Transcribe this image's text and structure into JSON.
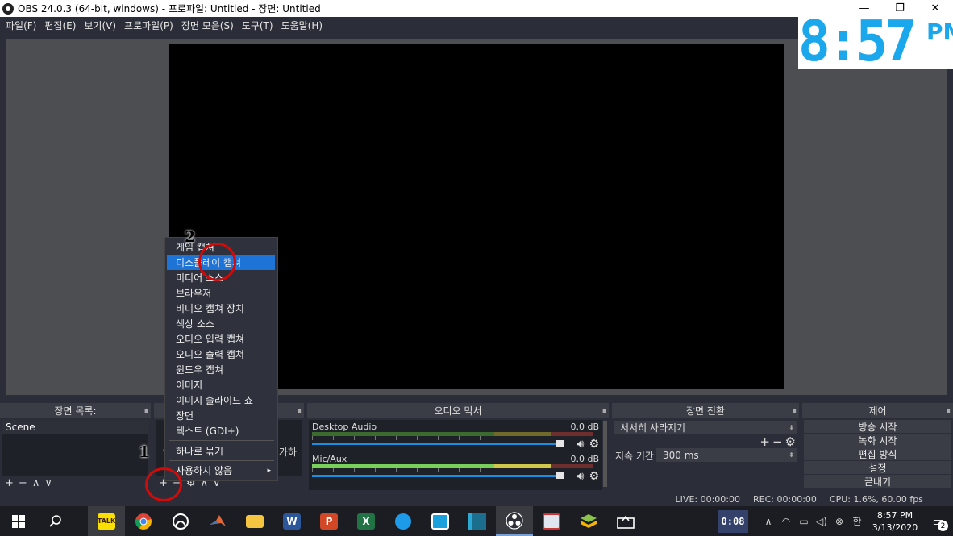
{
  "window": {
    "title": "OBS 24.0.3 (64-bit, windows) - 프로파일: Untitled - 장면: Untitled"
  },
  "menu": [
    "파일(F)",
    "편집(E)",
    "보기(V)",
    "프로파일(P)",
    "장면 모음(S)",
    "도구(T)",
    "도움말(H)"
  ],
  "clock_overlay": {
    "time": "8:57",
    "ampm": "PM"
  },
  "docks": {
    "scenes": {
      "title": "장면 목록:",
      "items": [
        "Scene"
      ],
      "footer": [
        "+",
        "−",
        "∧",
        "∨"
      ]
    },
    "sources": {
      "partial_text_left": "C",
      "partial_text_right": "가하",
      "footer": [
        "+",
        "−",
        "⚙",
        "∧",
        "∨"
      ]
    },
    "mixer": {
      "title": "오디오 믹서",
      "channels": [
        {
          "name": "Desktop Audio",
          "level": "0.0 dB",
          "active": false
        },
        {
          "name": "Mic/Aux",
          "level": "0.0 dB",
          "active": true
        }
      ]
    },
    "transitions": {
      "title": "장면 전환",
      "selected": "서서히 사라지기",
      "duration_label": "지속 기간",
      "duration_value": "300 ms"
    },
    "controls": {
      "title": "제어",
      "buttons": [
        "방송 시작",
        "녹화 시작",
        "편집 방식",
        "설정",
        "끝내기"
      ]
    }
  },
  "status": {
    "live": "LIVE: 00:00:00",
    "rec": "REC: 00:00:00",
    "cpu": "CPU: 1.6%, 60.00 fps"
  },
  "context_menu": {
    "items": [
      "게임 캡쳐",
      "디스플레이 캡쳐",
      "미디어 소스",
      "브라우저",
      "비디오 캡쳐 장치",
      "색상 소스",
      "오디오 입력 캡쳐",
      "오디오 출력 캡쳐",
      "윈도우 캡쳐",
      "이미지",
      "이미지 슬라이드 쇼",
      "장면",
      "텍스트 (GDI+)"
    ],
    "highlighted": "디스플레이 캡쳐",
    "group": "하나로 묶기",
    "deprecated": "사용하지 않음"
  },
  "annotations": {
    "step1": "1",
    "step2": "2"
  },
  "taskbar": {
    "apps": [
      "windows-start-icon",
      "search-icon",
      "kakaotalk-icon",
      "chrome-icon",
      "xbox-icon",
      "matlab-icon",
      "file-explorer-icon",
      "word-icon",
      "powerpoint-icon",
      "excel-icon",
      "feedback-icon",
      "app-icon",
      "studio-icon",
      "obs-icon",
      "photos-icon",
      "bluestacks-icon",
      "capture-icon"
    ],
    "kakao_label": "TALK",
    "word_label": "W",
    "ppt_label": "P",
    "excel_label": "X",
    "timer": "0:08",
    "ime": "한",
    "time": "8:57 PM",
    "date": "3/13/2020",
    "notifications": "2"
  }
}
